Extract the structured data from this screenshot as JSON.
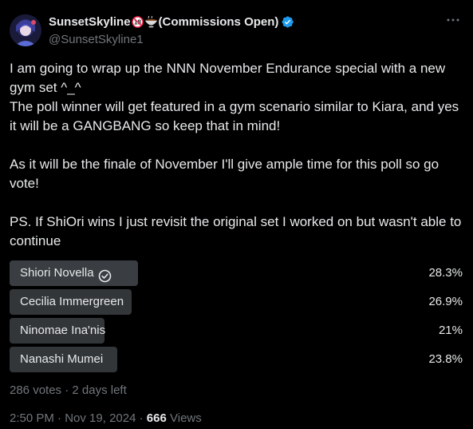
{
  "author": {
    "display_name": "SunsetSkyline",
    "name_suffix": "(Commissions Open)",
    "handle": "@SunsetSkyline1",
    "verified": true,
    "accent": "#1d9bf0"
  },
  "tweet": {
    "lines": [
      "I am going to wrap up the NNN November Endurance special with a new gym set ^_^",
      "The poll winner will get featured in a gym scenario similar to Kiara, and yes it will be a GANGBANG so keep that in mind!",
      "As it will be the finale of November I'll give ample time for this poll so go vote!",
      "PS. If ShiOri wins I just revisit the original set I worked on but wasn't able to continue"
    ]
  },
  "poll": {
    "options": [
      {
        "label": "Shiori Novella",
        "percent_text": "28.3%",
        "percent": 28.3,
        "selected": true
      },
      {
        "label": "Cecilia Immergreen",
        "percent_text": "26.9%",
        "percent": 26.9,
        "selected": false
      },
      {
        "label": "Ninomae Ina'nis",
        "percent_text": "21%",
        "percent": 21,
        "selected": false
      },
      {
        "label": "Nanashi Mumei",
        "percent_text": "23.8%",
        "percent": 23.8,
        "selected": false
      }
    ],
    "votes_text": "286 votes",
    "separator": "·",
    "time_left": "2 days left"
  },
  "meta": {
    "time": "2:50 PM",
    "separator": "·",
    "date": "Nov 19, 2024",
    "views_count": "666",
    "views_label": "Views"
  },
  "icons": {
    "more": "more-horizontal-icon",
    "verified": "verified-badge-icon",
    "check": "check-circle-icon",
    "age_restricted": "18-plus-emoji-icon",
    "bowl": "bowl-emoji-icon"
  }
}
